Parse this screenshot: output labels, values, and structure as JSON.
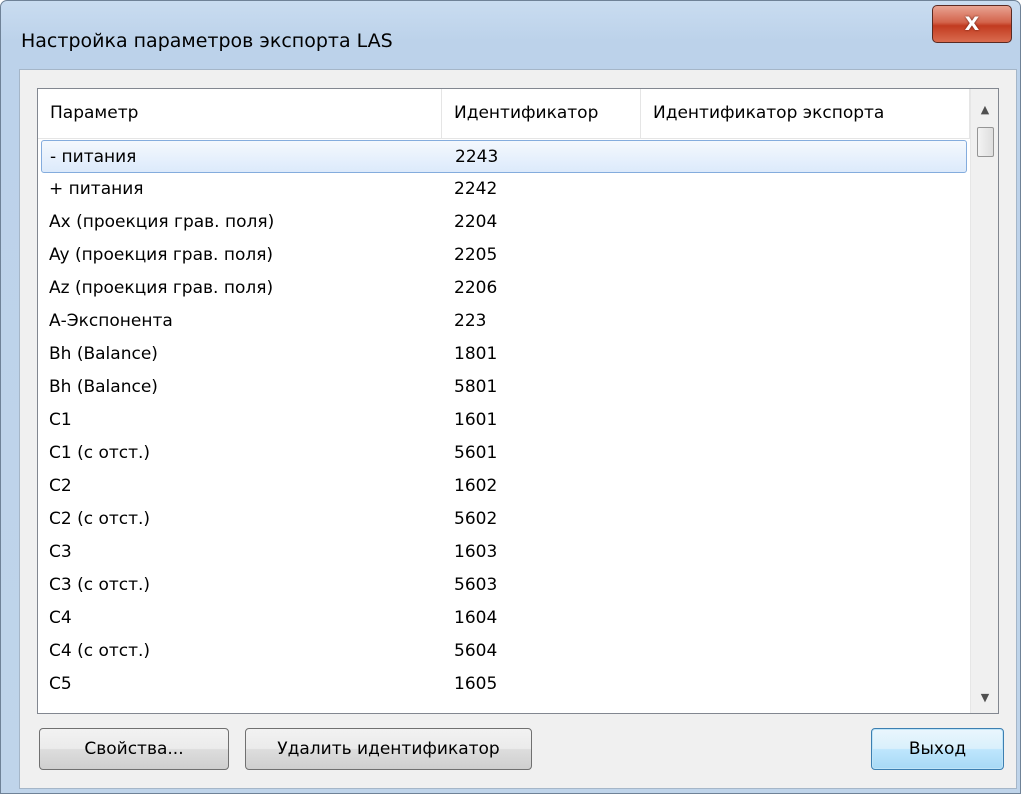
{
  "window": {
    "title": "Настройка параметров экспорта LAS",
    "close_glyph": "X",
    "close_icon": "close-icon"
  },
  "table": {
    "columns": [
      "Параметр",
      "Идентификатор",
      "Идентификатор экспорта"
    ],
    "selected_index": 0,
    "rows": [
      {
        "param": "- питания",
        "id": "2243",
        "export_id": ""
      },
      {
        "param": "+ питания",
        "id": "2242",
        "export_id": ""
      },
      {
        "param": "Ax (проекция грав. поля)",
        "id": "2204",
        "export_id": ""
      },
      {
        "param": "Ay (проекция грав. поля)",
        "id": "2205",
        "export_id": ""
      },
      {
        "param": "Az (проекция грав. поля)",
        "id": "2206",
        "export_id": ""
      },
      {
        "param": "А-Экспонента",
        "id": "223",
        "export_id": ""
      },
      {
        "param": "Bh (Balance)",
        "id": "1801",
        "export_id": ""
      },
      {
        "param": "Bh (Balance)",
        "id": "5801",
        "export_id": ""
      },
      {
        "param": "C1",
        "id": "1601",
        "export_id": ""
      },
      {
        "param": "C1 (с отст.)",
        "id": "5601",
        "export_id": ""
      },
      {
        "param": "C2",
        "id": "1602",
        "export_id": ""
      },
      {
        "param": "C2 (с отст.)",
        "id": "5602",
        "export_id": ""
      },
      {
        "param": "C3",
        "id": "1603",
        "export_id": ""
      },
      {
        "param": "C3 (с отст.)",
        "id": "5603",
        "export_id": ""
      },
      {
        "param": "C4",
        "id": "1604",
        "export_id": ""
      },
      {
        "param": "C4 (с отст.)",
        "id": "5604",
        "export_id": ""
      },
      {
        "param": "C5",
        "id": "1605",
        "export_id": ""
      }
    ]
  },
  "scrollbar": {
    "up_glyph": "▲",
    "down_glyph": "▼"
  },
  "buttons": {
    "properties": "Свойства...",
    "delete_id": "Удалить идентификатор",
    "exit": "Выход"
  }
}
